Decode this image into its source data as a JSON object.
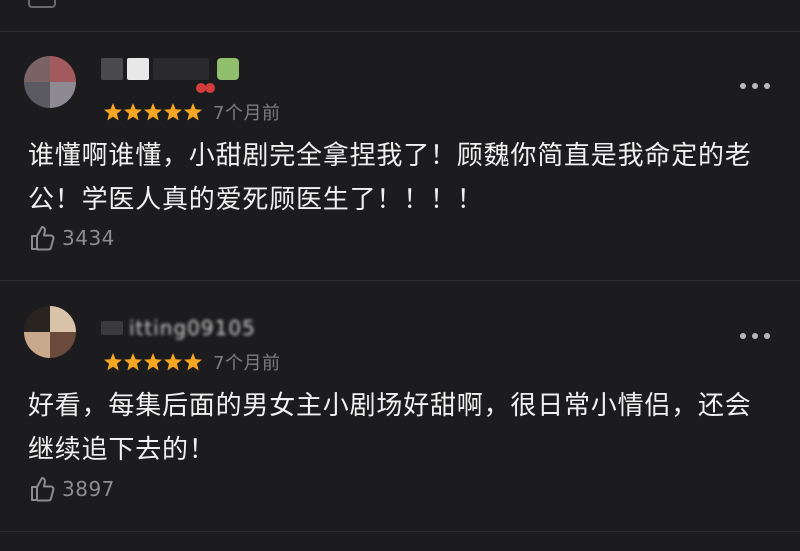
{
  "comments": [
    {
      "username_hidden": "",
      "time": "7个月前",
      "rating": 5,
      "text": "谁懂啊谁懂，小甜剧完全拿捏我了！顾魏你简直是我命定的老公！学医人真的爱死顾医生了！！！！",
      "likes": "3434",
      "avatar_colors": [
        "#7a6265",
        "#a35a5c",
        "#5a5a60",
        "#8e8a92"
      ]
    },
    {
      "username_hidden": "itting09105",
      "time": "7个月前",
      "rating": 5,
      "text": "好看，每集后面的男女主小剧场好甜啊，很日常小情侣，还会继续追下去的！",
      "likes": "3897",
      "avatar_colors": [
        "#2a2420",
        "#d9c3a8",
        "#c9a98b",
        "#6a4a3a"
      ]
    }
  ],
  "colors": {
    "background": "#1c1c1e",
    "star": "#f5a623",
    "divider": "#2e2e31"
  }
}
